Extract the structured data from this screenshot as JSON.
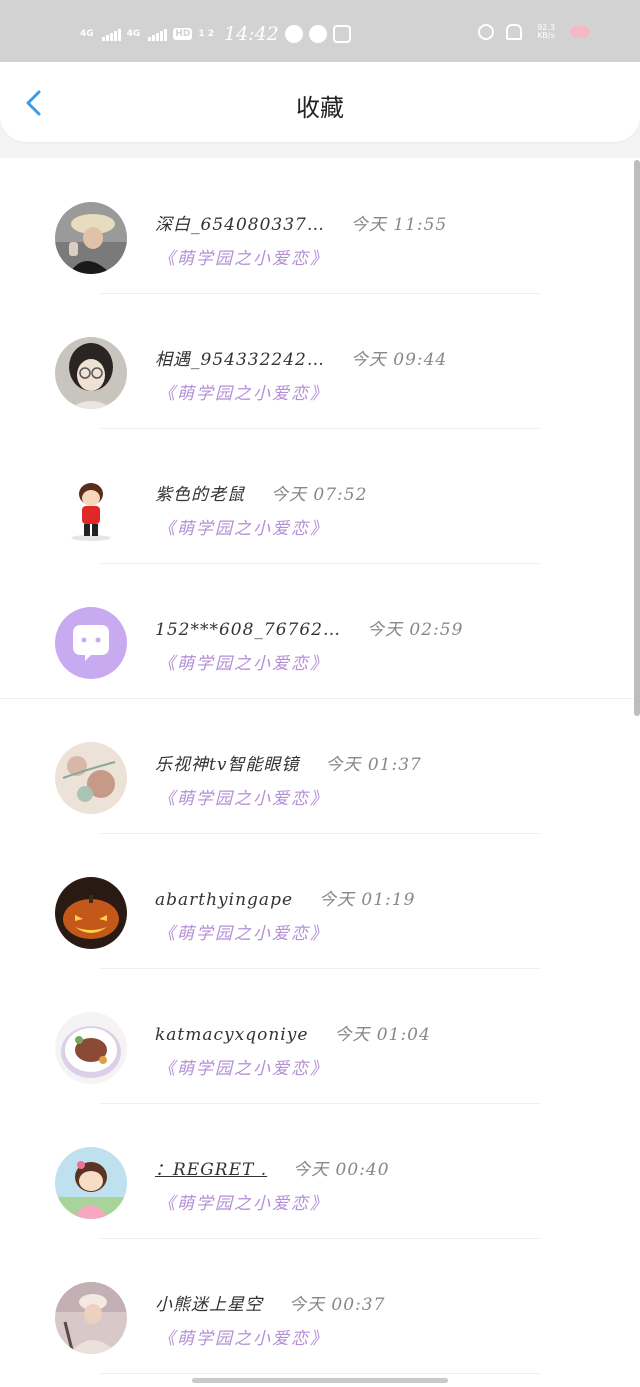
{
  "status_bar": {
    "net1": "4G",
    "net2": "4G",
    "hd": "HD",
    "hd_sub": "1 2",
    "time": "14:42",
    "speed": "92.3 KB/s",
    "icons": [
      "wechat-icon",
      "compass-icon",
      "image-icon",
      "alarm-icon",
      "mute-bell-icon",
      "pig-icon"
    ]
  },
  "header": {
    "title": "收藏",
    "back_icon": "chevron-left-icon",
    "accent": "#3a9ce8"
  },
  "colors": {
    "subtitle": "#b48fd6",
    "status_bar_bg": "#d2d2d2"
  },
  "items": [
    {
      "name": "深白_654080337…",
      "time": "今天 11:55",
      "subtitle": "《萌学园之小爱恋》",
      "avatar": "photo-girl-bucket-hat"
    },
    {
      "name": "相遇_954332242…",
      "time": "今天 09:44",
      "subtitle": "《萌学园之小爱恋》",
      "avatar": "photo-boy-glasses"
    },
    {
      "name": "紫色的老鼠",
      "time": "今天 07:52",
      "subtitle": "《萌学园之小爱恋》",
      "avatar": "cartoon-boy-red"
    },
    {
      "name": "152***608_76762…",
      "time": "今天 02:59",
      "subtitle": "《萌学园之小爱恋》",
      "avatar": "default-chat-avatar"
    },
    {
      "name": "乐视神tv智能眼镜",
      "time": "今天 01:37",
      "subtitle": "《萌学园之小爱恋》",
      "avatar": "floral-painting"
    },
    {
      "name": "abarthyingape",
      "time": "今天 01:19",
      "subtitle": "《萌学园之小爱恋》",
      "avatar": "pumpkin-lantern"
    },
    {
      "name": "katmacyxqoniye",
      "time": "今天 01:04",
      "subtitle": "《萌学园之小爱恋》",
      "avatar": "food-plate"
    },
    {
      "name": "：REGRET .",
      "time": "今天 00:40",
      "subtitle": "《萌学园之小爱恋》",
      "avatar": "cartoon-girl-pink"
    },
    {
      "name": "小熊迷上星空",
      "time": "今天 00:37",
      "subtitle": "《萌学园之小爱恋》",
      "avatar": "photo-girl-cap"
    }
  ]
}
